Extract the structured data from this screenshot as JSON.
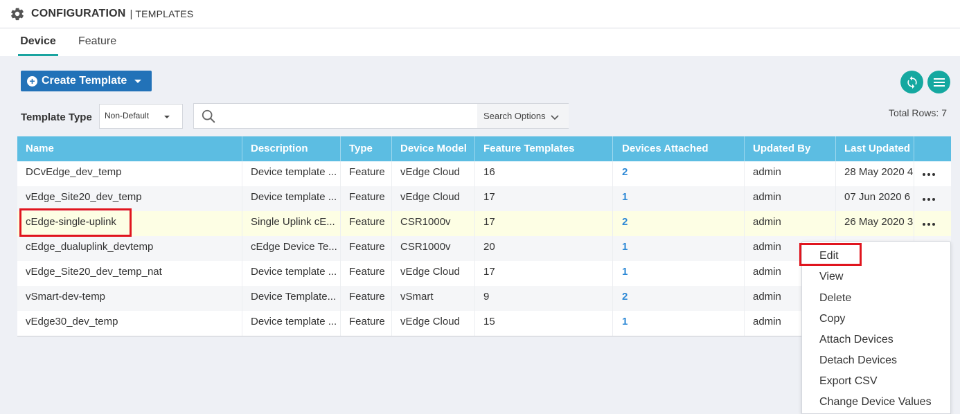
{
  "header": {
    "title": "CONFIGURATION",
    "separator": "|",
    "subtitle": "TEMPLATES"
  },
  "tabs": [
    {
      "label": "Device",
      "active": true
    },
    {
      "label": "Feature",
      "active": false
    }
  ],
  "toolbar": {
    "create_label": "Create Template",
    "template_type_label": "Template Type",
    "template_type_value": "Non-Default",
    "search_placeholder": "",
    "search_options_label": "Search Options",
    "total_rows": "Total Rows: 7"
  },
  "table": {
    "columns": [
      "Name",
      "Description",
      "Type",
      "Device Model",
      "Feature Templates",
      "Devices Attached",
      "Updated By",
      "Last Updated",
      ""
    ],
    "rows": [
      {
        "name": "DCvEdge_dev_temp",
        "description": "Device template ...",
        "type": "Feature",
        "model": "vEdge Cloud",
        "feature_templates": "16",
        "devices_attached": "2",
        "updated_by": "admin",
        "last_updated": "28 May 2020 4"
      },
      {
        "name": "vEdge_Site20_dev_temp",
        "description": "Device template ...",
        "type": "Feature",
        "model": "vEdge Cloud",
        "feature_templates": "17",
        "devices_attached": "1",
        "updated_by": "admin",
        "last_updated": "07 Jun 2020 6"
      },
      {
        "name": "cEdge-single-uplink",
        "description": "Single Uplink cE...",
        "type": "Feature",
        "model": "CSR1000v",
        "feature_templates": "17",
        "devices_attached": "2",
        "updated_by": "admin",
        "last_updated": "26 May 2020 3"
      },
      {
        "name": "cEdge_dualuplink_devtemp",
        "description": "cEdge Device Te...",
        "type": "Feature",
        "model": "CSR1000v",
        "feature_templates": "20",
        "devices_attached": "1",
        "updated_by": "admin",
        "last_updated": ""
      },
      {
        "name": "vEdge_Site20_dev_temp_nat",
        "description": "Device template ...",
        "type": "Feature",
        "model": "vEdge Cloud",
        "feature_templates": "17",
        "devices_attached": "1",
        "updated_by": "admin",
        "last_updated": ""
      },
      {
        "name": "vSmart-dev-temp",
        "description": "Device Template...",
        "type": "Feature",
        "model": "vSmart",
        "feature_templates": "9",
        "devices_attached": "2",
        "updated_by": "admin",
        "last_updated": ""
      },
      {
        "name": "vEdge30_dev_temp",
        "description": "Device template ...",
        "type": "Feature",
        "model": "vEdge Cloud",
        "feature_templates": "15",
        "devices_attached": "1",
        "updated_by": "admin",
        "last_updated": ""
      }
    ]
  },
  "context_menu": {
    "items": [
      "Edit",
      "View",
      "Delete",
      "Copy",
      "Attach Devices",
      "Detach Devices",
      "Export CSV",
      "Change Device Values"
    ]
  },
  "icons": {
    "header": "gear-icon",
    "refresh": "refresh-icon",
    "menu": "hamburger-icon",
    "search": "search-icon"
  },
  "colors": {
    "primary_button": "#2272b8",
    "accent_teal": "#15a8a0",
    "table_header": "#5cbde2",
    "link": "#2e89d6",
    "highlight_row": "#fdfee4",
    "annotation_red": "#e0151e"
  }
}
